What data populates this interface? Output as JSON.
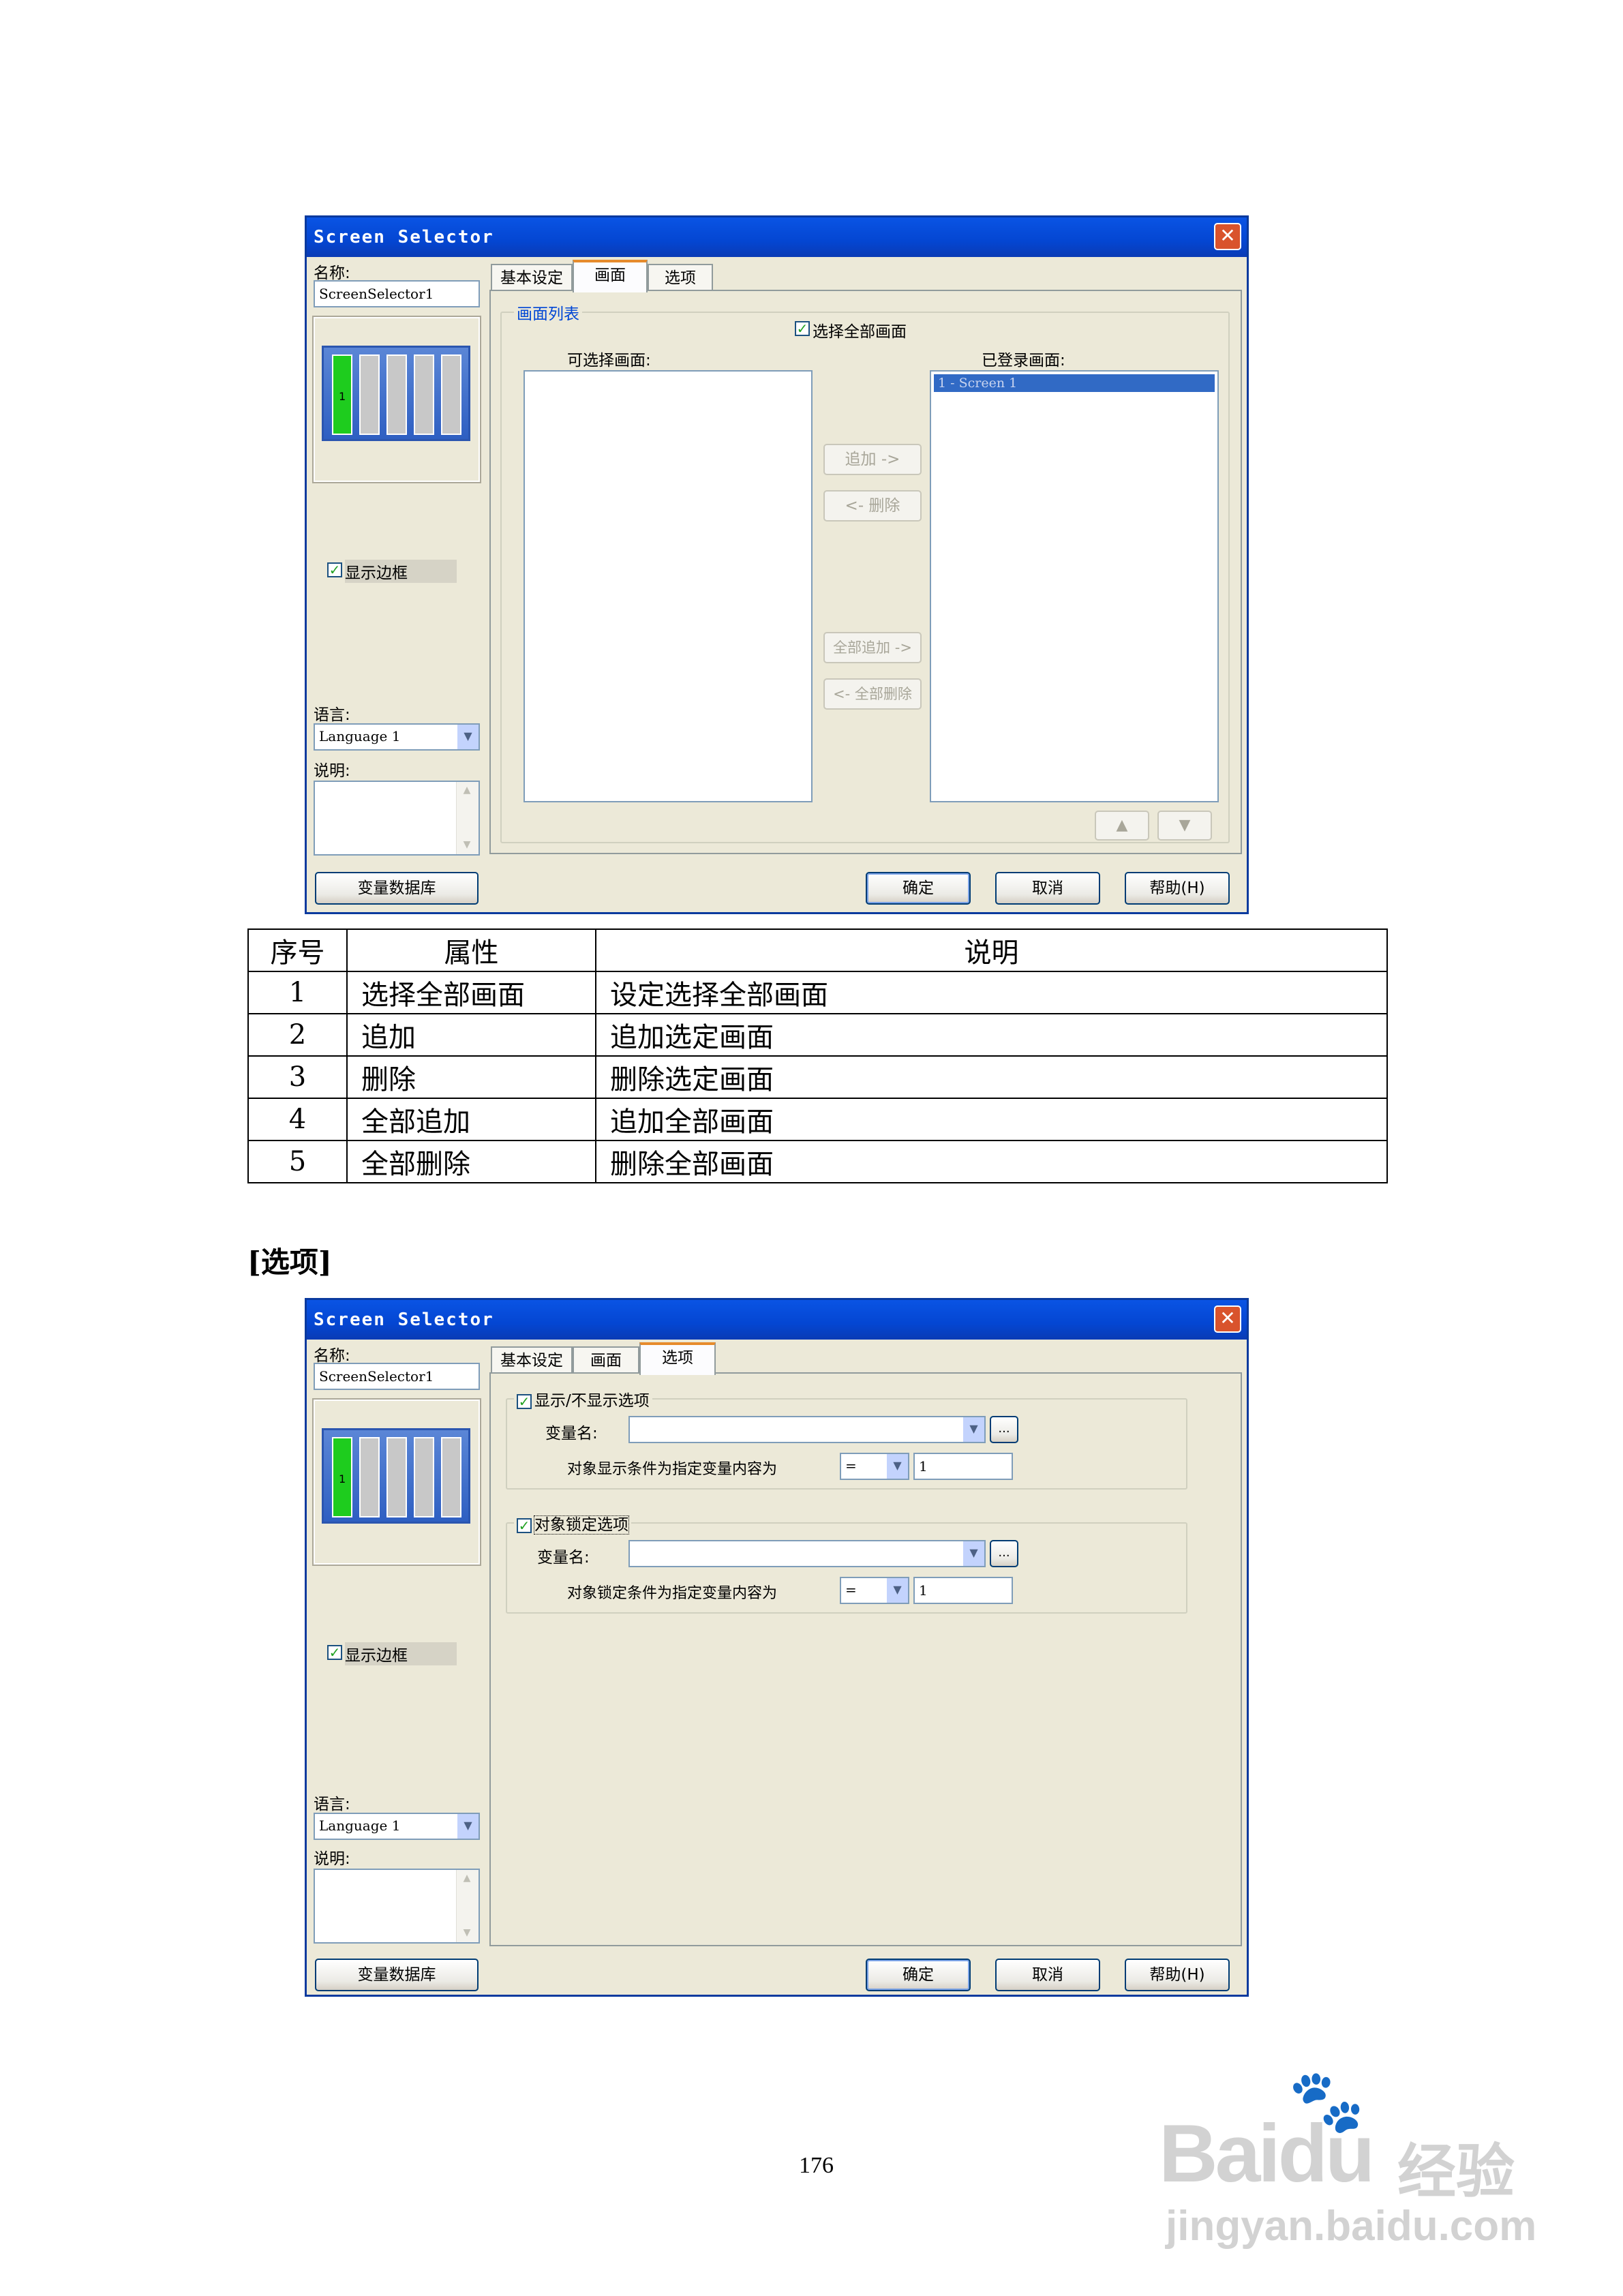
{
  "dialog1": {
    "title": "Screen Selector",
    "close": "✕",
    "name_label": "名称:",
    "name_value": "ScreenSelector1",
    "preview_cell": "1",
    "show_border_label": "显示边框",
    "show_border_checked": true,
    "language_label": "语言:",
    "language_value": "Language 1",
    "note_label": "说明:",
    "tabs": [
      "基本设定",
      "画面",
      "选项"
    ],
    "selected_tab": "画面",
    "group_title": "画面列表",
    "select_all_label": "选择全部画面",
    "select_all_checked": true,
    "available_label": "可选择画面:",
    "registered_label": "已登录画面:",
    "registered_items": [
      "1 - Screen 1"
    ],
    "btn_add": "追加 ->",
    "btn_delete": "<- 删除",
    "btn_add_all": "全部追加 ->",
    "btn_delete_all": "<- 全部删除",
    "btn_up": "▲",
    "btn_down": "▼",
    "btn_database": "变量数据库",
    "btn_ok": "确定",
    "btn_cancel": "取消",
    "btn_help": "帮助(H)"
  },
  "table": {
    "headers": [
      "序号",
      "属性",
      "说明"
    ],
    "rows": [
      [
        "1",
        "选择全部画面",
        "设定选择全部画面"
      ],
      [
        "2",
        "追加",
        "追加选定画面"
      ],
      [
        "3",
        "删除",
        "删除选定画面"
      ],
      [
        "4",
        "全部追加",
        "追加全部画面"
      ],
      [
        "5",
        "全部删除",
        "删除全部画面"
      ]
    ]
  },
  "section_heading": "[选项]",
  "dialog2": {
    "title": "Screen Selector",
    "close": "✕",
    "name_label": "名称:",
    "name_value": "ScreenSelector1",
    "preview_cell": "1",
    "show_border_label": "显示边框",
    "show_border_checked": true,
    "language_label": "语言:",
    "language_value": "Language 1",
    "note_label": "说明:",
    "tabs": [
      "基本设定",
      "画面",
      "选项"
    ],
    "selected_tab": "选项",
    "group1_title": "显示/不显示选项",
    "group1_checked": true,
    "group1_var_label": "变量名:",
    "group1_var_value": "",
    "group1_cond_label": "对象显示条件为指定变量内容为",
    "group1_operator": "=",
    "group1_value": "1",
    "group2_title": "对象锁定选项",
    "group2_checked": true,
    "group2_var_label": "变量名:",
    "group2_var_value": "",
    "group2_cond_label": "对象锁定条件为指定变量内容为",
    "group2_operator": "=",
    "group2_value": "1",
    "browse": "...",
    "btn_database": "变量数据库",
    "btn_ok": "确定",
    "btn_cancel": "取消",
    "btn_help": "帮助(H)"
  },
  "page_number": "176",
  "watermark": {
    "brand": "Bai",
    "brand2": "du",
    "cn": "经验",
    "url": "jingyan.baidu.com"
  }
}
